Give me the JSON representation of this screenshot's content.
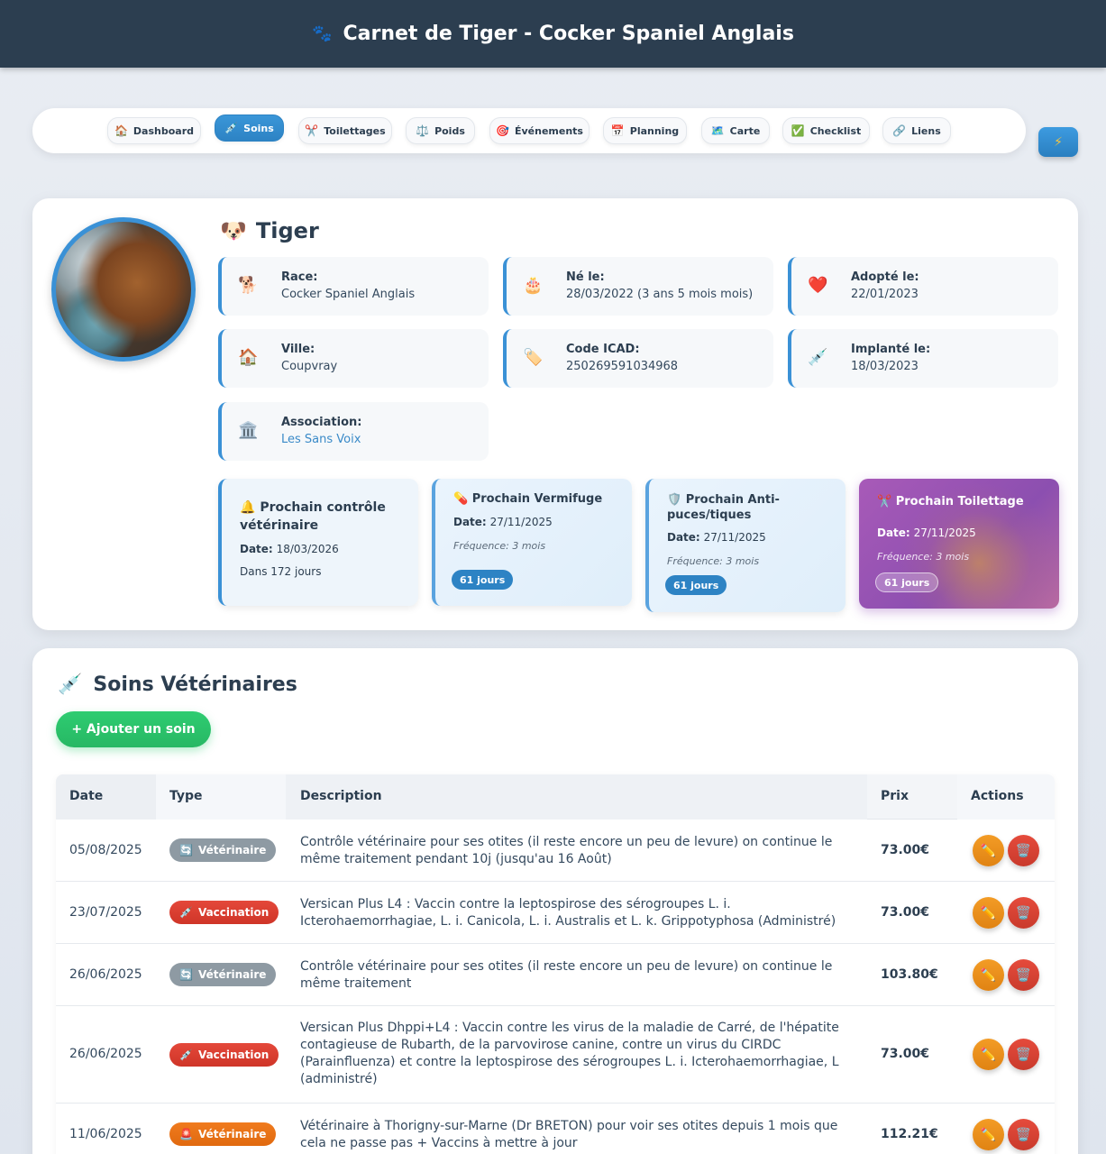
{
  "header": {
    "paw_icon": "paw-icon",
    "title": "Carnet de Tiger - Cocker Spaniel Anglais"
  },
  "nav": {
    "items": [
      {
        "icon": "🏠",
        "label": "Dashboard"
      },
      {
        "icon": "💉",
        "label": "Soins"
      },
      {
        "icon": "✂️",
        "label": "Toilettages"
      },
      {
        "icon": "⚖️",
        "label": "Poids"
      },
      {
        "icon": "🎯",
        "label": "Événements"
      },
      {
        "icon": "📅",
        "label": "Planning"
      },
      {
        "icon": "🗺️",
        "label": "Carte"
      },
      {
        "icon": "✅",
        "label": "Checklist"
      },
      {
        "icon": "🔗",
        "label": "Liens"
      }
    ],
    "active": "Soins",
    "quick_icon": "⚡"
  },
  "profile": {
    "name_icon": "🐶",
    "name": "Tiger",
    "fields": [
      {
        "icon": "🐕",
        "label": "Race:",
        "value": "Cocker Spaniel Anglais"
      },
      {
        "icon": "🎂",
        "label": "Né le:",
        "value": "28/03/2022 (3 ans 5 mois mois)"
      },
      {
        "icon": "❤️",
        "label": "Adopté le:",
        "value": "22/01/2023"
      },
      {
        "icon": "🏠",
        "label": "Ville:",
        "value": "Coupvray"
      },
      {
        "icon": "🏷️",
        "label": "Code ICAD:",
        "value": "250269591034968"
      },
      {
        "icon": "💉",
        "label": "Implanté le:",
        "value": "18/03/2023"
      },
      {
        "icon": "🏛️",
        "label": "Association:",
        "value": "Les Sans Voix"
      }
    ],
    "reminders": {
      "vet": {
        "icon": "🔔",
        "title": "Prochain contrôle vétérinaire",
        "date_label": "Date:",
        "date": "18/03/2026",
        "remaining": "Dans 172 jours"
      },
      "worm": {
        "icon": "💊",
        "title": "Prochain Vermifuge",
        "date_label": "Date:",
        "date": "27/11/2025",
        "freq": "Fréquence: 3 mois",
        "days": "61 jours"
      },
      "flea": {
        "icon": "🛡️",
        "title": "Prochain Anti-puces/tiques",
        "date_label": "Date:",
        "date": "27/11/2025",
        "freq": "Fréquence: 3 mois",
        "days": "61 jours"
      },
      "groom": {
        "icon": "✂️",
        "title": "Prochain Toilettage",
        "date_label": "Date:",
        "date": "27/11/2025",
        "freq": "Fréquence: 3 mois",
        "days": "61 jours"
      }
    }
  },
  "care": {
    "icon": "💉",
    "title": "Soins Vétérinaires",
    "add_label": "+ Ajouter un soin",
    "columns": [
      "Date",
      "Type",
      "Description",
      "Prix",
      "Actions"
    ],
    "rows": [
      {
        "date": "05/08/2025",
        "type_icon": "🔄",
        "type": "Vétérinaire",
        "desc": "Contrôle vétérinaire pour ses otites (il reste encore un peu de levure) on continue le même traitement pendant 10j (jusqu'au 16 Août)",
        "price": "73.00€"
      },
      {
        "date": "23/07/2025",
        "type_icon": "💉",
        "type": "Vaccination",
        "desc": "Versican Plus L4 : Vaccin contre la leptospirose des sérogroupes L. i. Icterohaemorrhagiae, L. i. Canicola, L. i. Australis et L. k. Grippotyphosa (Administré)",
        "price": "73.00€"
      },
      {
        "date": "26/06/2025",
        "type_icon": "🔄",
        "type": "Vétérinaire",
        "desc": "Contrôle vétérinaire pour ses otites (il reste encore un peu de levure) on continue le même traitement",
        "price": "103.80€"
      },
      {
        "date": "26/06/2025",
        "type_icon": "💉",
        "type": "Vaccination",
        "desc": "Versican Plus Dhppi+L4 : Vaccin contre les virus de la maladie de Carré, de l'hépatite contagieuse de Rubarth, de la parvovirose canine, contre un virus du CIRDC (Parainfluenza) et contre la leptospirose des sérogroupes L. i. Icterohaemorrhagiae, L (administré)",
        "price": "73.00€"
      },
      {
        "date": "11/06/2025",
        "type_icon": "🚨",
        "type": "Vétérinaire",
        "desc": "Vétérinaire à Thorigny-sur-Marne (Dr BRETON) pour voir ses otites depuis 1 mois que cela ne passe pas + Vaccins à mettre à jour",
        "price": "112.21€"
      }
    ],
    "edit_icon": "✏️",
    "delete_icon": "🗑️"
  }
}
